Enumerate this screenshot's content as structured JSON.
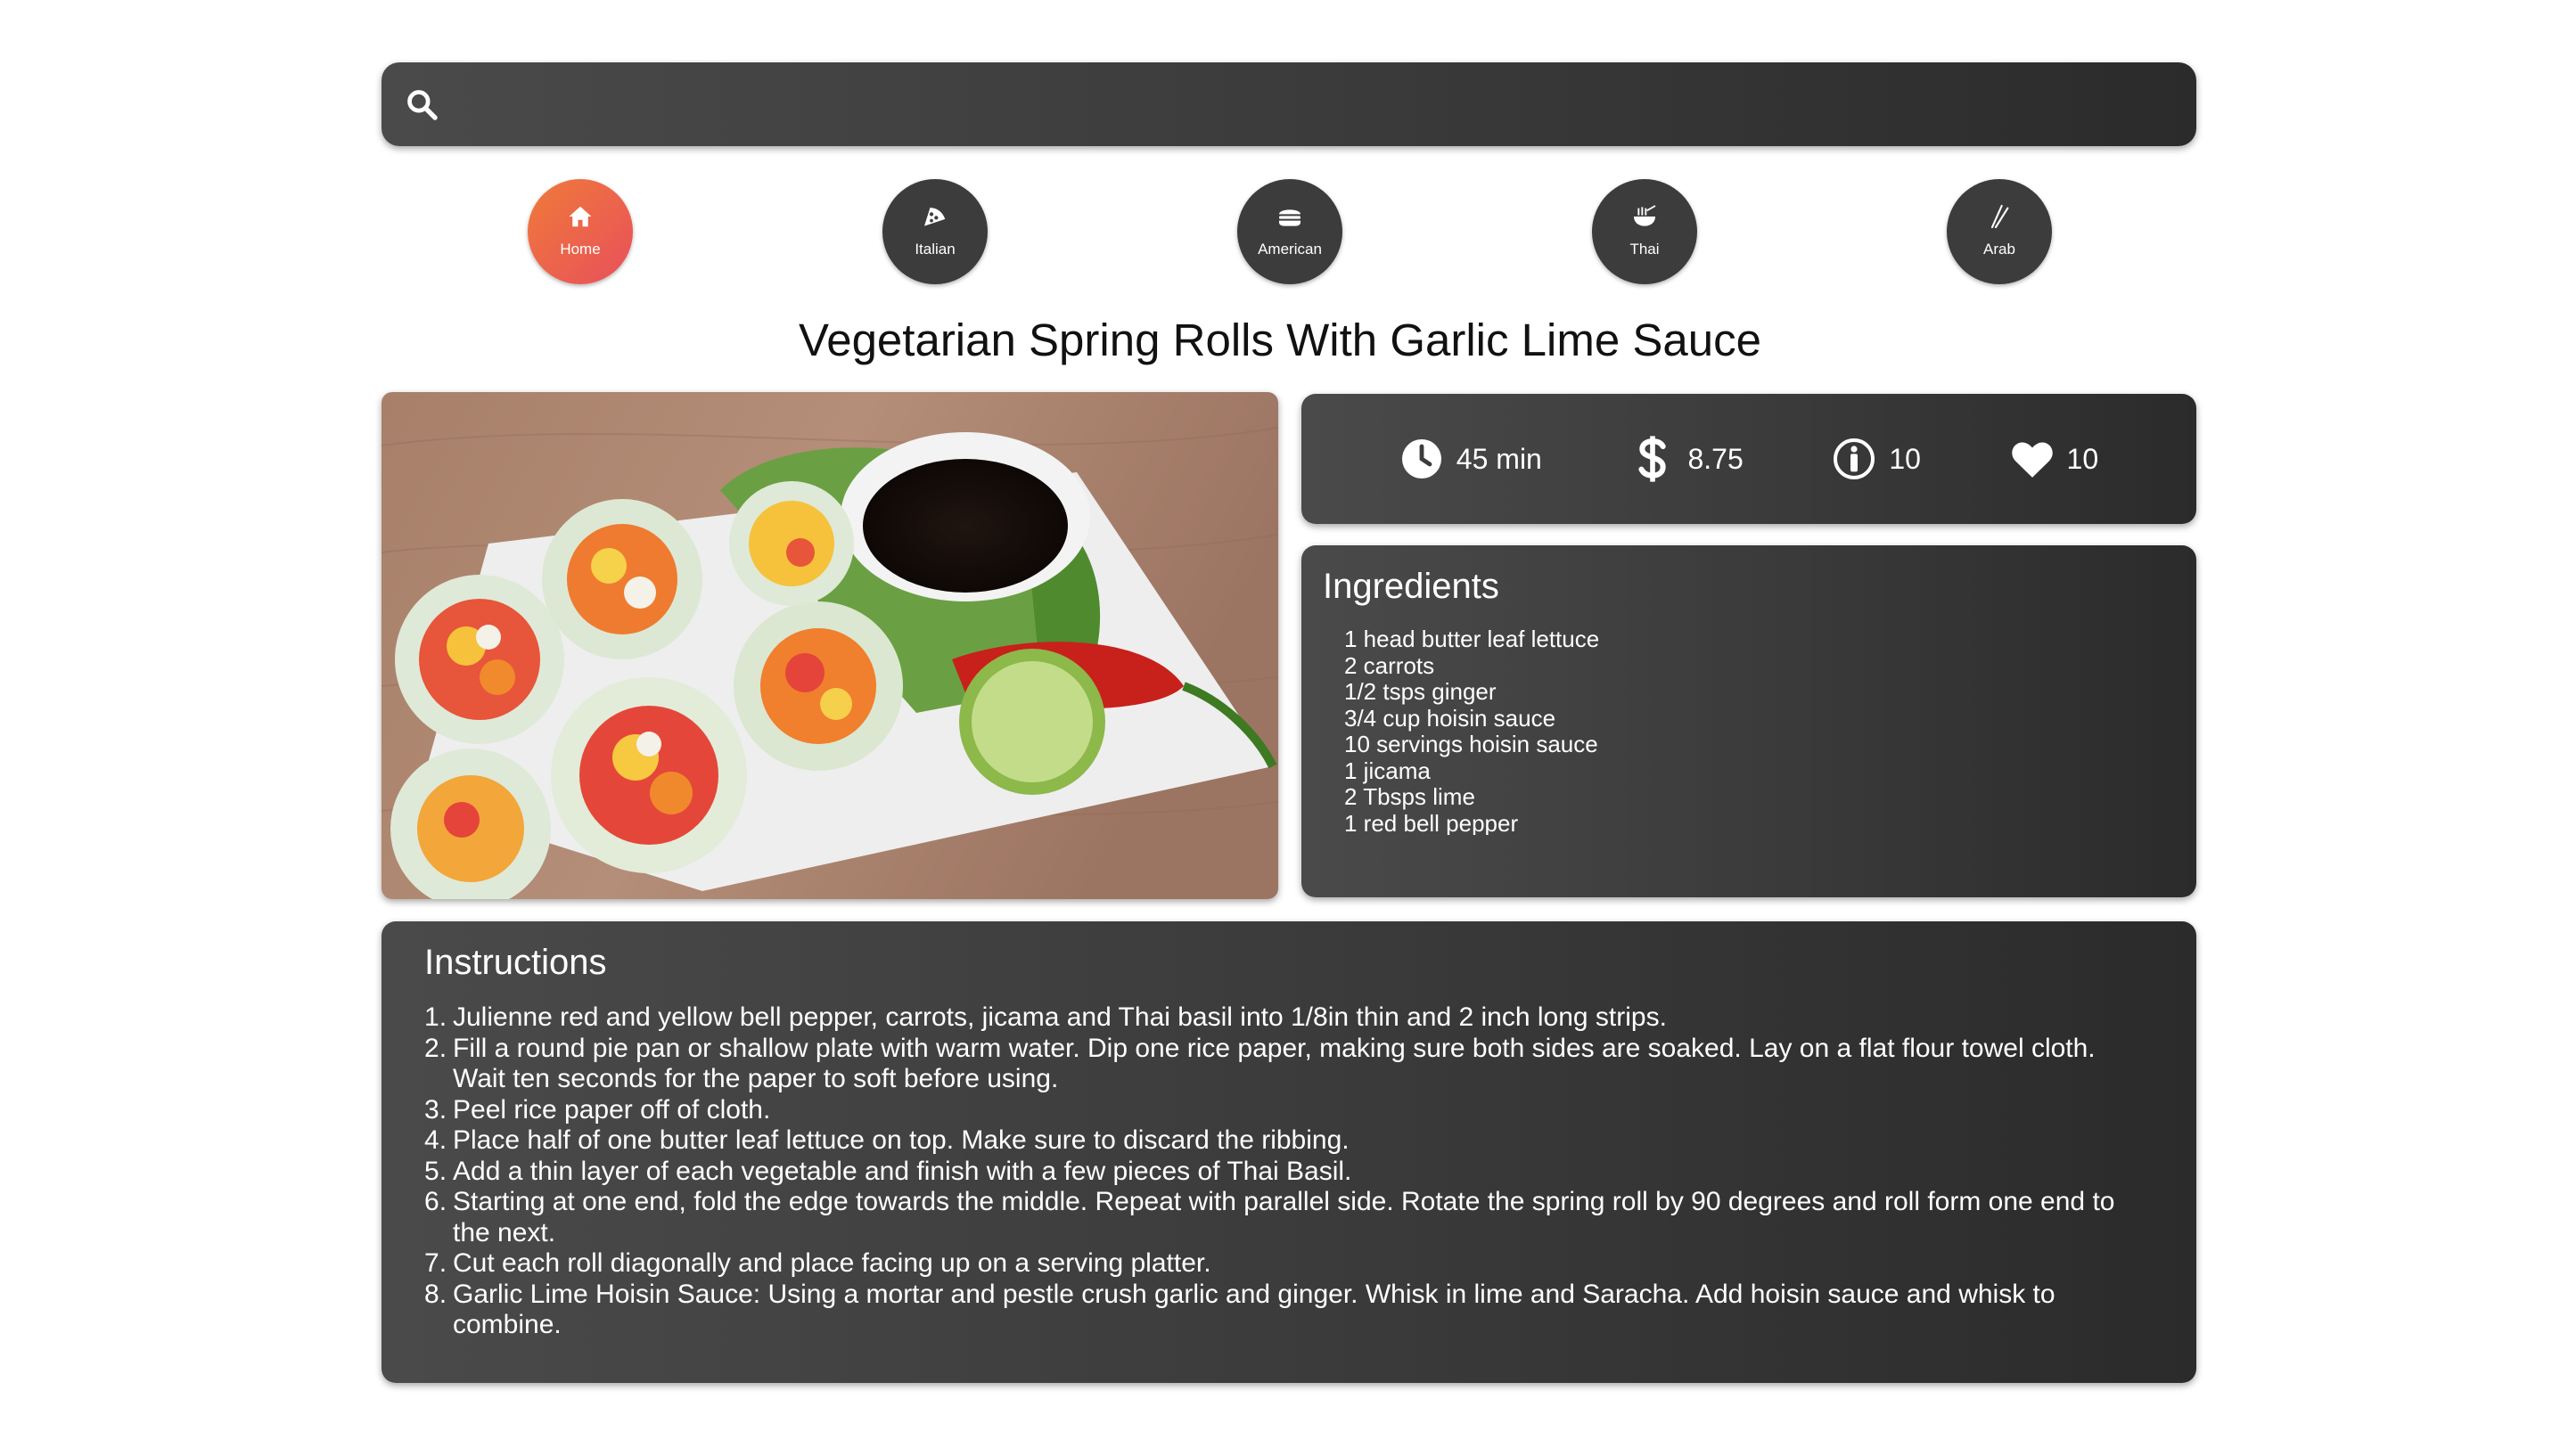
{
  "search": {
    "placeholder": "",
    "icon": "search-icon"
  },
  "nav": {
    "items": [
      {
        "label": "Home",
        "icon": "home-icon",
        "active": true
      },
      {
        "label": "Italian",
        "icon": "pizza-icon",
        "active": false
      },
      {
        "label": "American",
        "icon": "burger-icon",
        "active": false
      },
      {
        "label": "Thai",
        "icon": "noodle-bowl-icon",
        "active": false
      },
      {
        "label": "Arab",
        "icon": "chopsticks-icon",
        "active": false
      }
    ]
  },
  "recipe": {
    "title": "Vegetarian Spring Rolls With Garlic Lime Sauce",
    "stats": {
      "time": "45 min",
      "price": "8.75",
      "servings": "10",
      "likes": "10"
    },
    "ingredients_title": "Ingredients",
    "ingredients": [
      "1 head butter leaf lettuce",
      "2 carrots",
      "1/2 tsps ginger",
      "3/4 cup hoisin sauce",
      "10 servings hoisin sauce",
      "1 jicama",
      "2 Tbsps lime",
      "1 red bell pepper"
    ],
    "instructions_title": "Instructions",
    "instructions": [
      "Julienne red and yellow bell pepper, carrots, jicama and Thai basil into 1/8in thin and 2 inch long strips.",
      "Fill a round pie pan or shallow plate with warm water. Dip one rice paper, making sure both sides are soaked. Lay on a flat flour towel cloth. Wait ten seconds for the paper to soft before using.",
      "Peel rice paper off of cloth.",
      "Place half of one butter leaf lettuce on top. Make sure to discard the ribbing.",
      "Add a thin layer of each vegetable and finish with a few pieces of Thai Basil.",
      "Starting at one end, fold the edge towards the middle. Repeat with parallel side. Rotate the spring roll by 90 degrees and roll form one end to the next.",
      "Cut each roll diagonally and place facing up on a serving platter.",
      "Garlic Lime Hoisin Sauce: Using a mortar and pestle crush garlic and ginger. Whisk in lime and Saracha. Add hoisin sauce and whisk to combine."
    ]
  },
  "colors": {
    "active_gradient_start": "#f07a3a",
    "active_gradient_end": "#e8505b",
    "panel": "#3c3c3c"
  }
}
